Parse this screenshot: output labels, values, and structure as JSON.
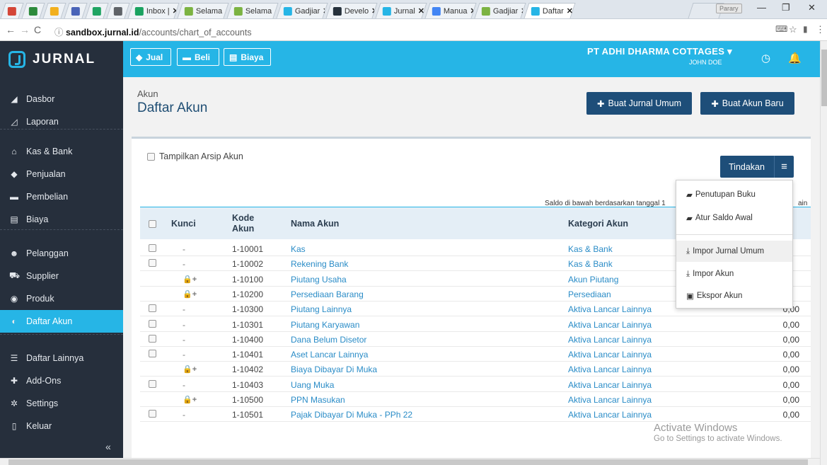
{
  "browser": {
    "tabs": [
      {
        "label": "",
        "color": "#d44638"
      },
      {
        "label": "",
        "color": "#2c8a3c"
      },
      {
        "label": "",
        "color": "#f2b01e"
      },
      {
        "label": "",
        "color": "#4a64b8"
      },
      {
        "label": "",
        "color": "#1fa463"
      },
      {
        "label": "",
        "color": "#5f6368"
      },
      {
        "label": "Inbox |",
        "color": "#1aa260"
      },
      {
        "label": "Selama",
        "color": "#7cb342"
      },
      {
        "label": "Selama",
        "color": "#7cb342"
      },
      {
        "label": "Gadjiar",
        "color": "#26b5e6"
      },
      {
        "label": "Develo",
        "color": "#26313c"
      },
      {
        "label": "Jurnal",
        "color": "#26b5e6"
      },
      {
        "label": "Manua",
        "color": "#4285f4"
      },
      {
        "label": "Gadjiar",
        "color": "#7cb342"
      },
      {
        "label": "Daftar",
        "color": "#26b5e6"
      }
    ],
    "profile": "Parary",
    "url_host": "sandbox.jurnal.id",
    "url_path": "/accounts/chart_of_accounts"
  },
  "sidebar": {
    "logo": "JURNAL",
    "items": [
      {
        "label": "Dasbor",
        "icon": "◢"
      },
      {
        "label": "Laporan",
        "icon": "◿"
      },
      {
        "label": "Kas & Bank",
        "icon": "⌂"
      },
      {
        "label": "Penjualan",
        "icon": "◆"
      },
      {
        "label": "Pembelian",
        "icon": "▬"
      },
      {
        "label": "Biaya",
        "icon": "▤"
      },
      {
        "label": "Pelanggan",
        "icon": "☻"
      },
      {
        "label": "Supplier",
        "icon": "⛟"
      },
      {
        "label": "Produk",
        "icon": "◉"
      },
      {
        "label": "Daftar Akun",
        "icon": "◐"
      },
      {
        "label": "Daftar Lainnya",
        "icon": "☰"
      },
      {
        "label": "Add-Ons",
        "icon": "✚"
      },
      {
        "label": "Settings",
        "icon": "✲"
      },
      {
        "label": "Keluar",
        "icon": "▯"
      }
    ],
    "collapse": "«"
  },
  "topbar": {
    "jual": "Jual",
    "beli": "Beli",
    "biaya": "Biaya",
    "company": "PT ADHI DHARMA COTTAGES ▾",
    "user": "JOHN DOE"
  },
  "page": {
    "crumb": "Akun",
    "title": "Daftar Akun",
    "btn_jurnal": "Buat Jurnal Umum",
    "btn_akun": "Buat Akun Baru",
    "archive_label": "Tampilkan Arsip Akun",
    "tindakan": "Tindakan",
    "saldo_note": "Saldo di bawah berdasarkan tanggal 1",
    "saldo_note_tail": "ain"
  },
  "table": {
    "headers": {
      "kunci": "Kunci",
      "kode": "Kode\nAkun",
      "nama": "Nama Akun",
      "kategori": "Kategori Akun"
    },
    "rows": [
      {
        "lock": "-",
        "kode": "1-10001",
        "nama": "Kas",
        "kategori": "Kas & Bank",
        "saldo": "",
        "check": true
      },
      {
        "lock": "-",
        "kode": "1-10002",
        "nama": "Rekening Bank",
        "kategori": "Kas & Bank",
        "saldo": "",
        "check": true
      },
      {
        "lock": "🔒+",
        "kode": "1-10100",
        "nama": "Piutang Usaha",
        "kategori": "Akun Piutang",
        "saldo": "",
        "check": false
      },
      {
        "lock": "🔒+",
        "kode": "1-10200",
        "nama": "Persediaan Barang",
        "kategori": "Persediaan",
        "saldo": "",
        "check": false
      },
      {
        "lock": "-",
        "kode": "1-10300",
        "nama": "Piutang Lainnya",
        "kategori": "Aktiva Lancar Lainnya",
        "saldo": "0,00",
        "check": true
      },
      {
        "lock": "-",
        "kode": "1-10301",
        "nama": "Piutang Karyawan",
        "kategori": "Aktiva Lancar Lainnya",
        "saldo": "0,00",
        "check": true
      },
      {
        "lock": "-",
        "kode": "1-10400",
        "nama": "Dana Belum Disetor",
        "kategori": "Aktiva Lancar Lainnya",
        "saldo": "0,00",
        "check": true
      },
      {
        "lock": "-",
        "kode": "1-10401",
        "nama": "Aset Lancar Lainnya",
        "kategori": "Aktiva Lancar Lainnya",
        "saldo": "0,00",
        "check": true
      },
      {
        "lock": "🔒+",
        "kode": "1-10402",
        "nama": "Biaya Dibayar Di Muka",
        "kategori": "Aktiva Lancar Lainnya",
        "saldo": "0,00",
        "check": false
      },
      {
        "lock": "-",
        "kode": "1-10403",
        "nama": "Uang Muka",
        "kategori": "Aktiva Lancar Lainnya",
        "saldo": "0,00",
        "check": true
      },
      {
        "lock": "🔒+",
        "kode": "1-10500",
        "nama": "PPN Masukan",
        "kategori": "Aktiva Lancar Lainnya",
        "saldo": "0,00",
        "check": false
      },
      {
        "lock": "-",
        "kode": "1-10501",
        "nama": "Pajak Dibayar Di Muka - PPh 22",
        "kategori": "Aktiva Lancar Lainnya",
        "saldo": "0,00",
        "check": true
      }
    ]
  },
  "menu": {
    "items": [
      "Penutupan Buku",
      "Atur Saldo Awal",
      "Impor Jurnal Umum",
      "Impor Akun",
      "Ekspor Akun"
    ]
  },
  "watermark": {
    "line1": "Activate Windows",
    "line2": "Go to Settings to activate Windows."
  },
  "colors": {
    "accent": "#26b5e6",
    "navy": "#1e4e79",
    "sidebar": "#262f3c",
    "link": "#2a8cc7"
  }
}
